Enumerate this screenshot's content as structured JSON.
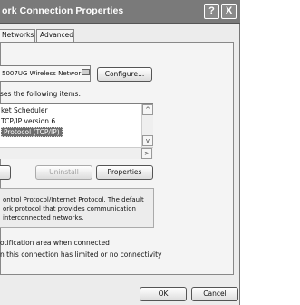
{
  "window": {
    "title": "ork Connection Properties",
    "help_label": "?",
    "close_label": "X"
  },
  "tabs": [
    {
      "label": "Networks"
    },
    {
      "label": "Advanced"
    }
  ],
  "adapter": {
    "name": "5007UG Wireless Networ",
    "configure_label": "Configure..."
  },
  "items_heading": "ses the following items:",
  "items": [
    {
      "label": "ket Scheduler",
      "selected": false
    },
    {
      "label": "TCP/IP version 6",
      "selected": false
    },
    {
      "label": "Protocol (TCP/IP)",
      "selected": true
    }
  ],
  "scroll": {
    "up": "^",
    "down": "v",
    "right": ">"
  },
  "actions": {
    "install_label": "",
    "uninstall_label": "Uninstall",
    "properties_label": "Properties"
  },
  "description": {
    "lines": [
      "ontrol Protocol/Internet Protocol. The default",
      "ork protocol that provides communication",
      "interconnected networks."
    ]
  },
  "options": [
    {
      "label": "otification area when connected"
    },
    {
      "label": "n this connection has limited or no connectivity"
    }
  ],
  "footer": {
    "ok_label": "OK",
    "cancel_label": "Cancel"
  }
}
